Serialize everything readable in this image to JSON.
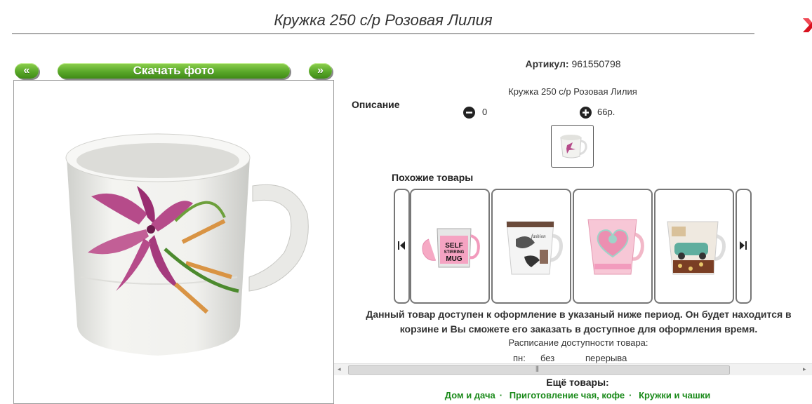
{
  "header": {
    "title": "Кружка 250 с/р Розовая Лилия"
  },
  "gallery": {
    "prev_label": "«",
    "download_label": "Скачать фото",
    "next_label": "»"
  },
  "product": {
    "articul_label": "Артикул:",
    "articul_value": "961550798",
    "description_label": "Описание",
    "description_text": "Кружка 250 с/р Розовая Лилия",
    "quantity": "0",
    "price": "66р."
  },
  "similar": {
    "title": "Похожие товары",
    "items": [
      {
        "name": "Self Stirring Mug",
        "mug_text": "SELF STIRRING MUG"
      },
      {
        "name": "Fashion"
      },
      {
        "name": "Pink heart"
      },
      {
        "name": "Cafe car"
      }
    ]
  },
  "availability": {
    "notice": "Данный товар доступен к оформление в указаный ниже период. Он будет находится в корзине и Вы сможете его заказать в доступное для оформления время.",
    "schedule_title": "Расписание доступности товара:",
    "schedule": [
      {
        "day": "пн:",
        "from": "без",
        "to": "перерыва"
      }
    ]
  },
  "more": {
    "title": "Ещё товары:",
    "links": [
      "Дом и дача",
      "Приготовление чая, кофе",
      "Кружки и чашки"
    ]
  },
  "colors": {
    "accent_green": "#5aa82a",
    "close_red": "#d8121f",
    "link_green": "#1a8a1a"
  }
}
